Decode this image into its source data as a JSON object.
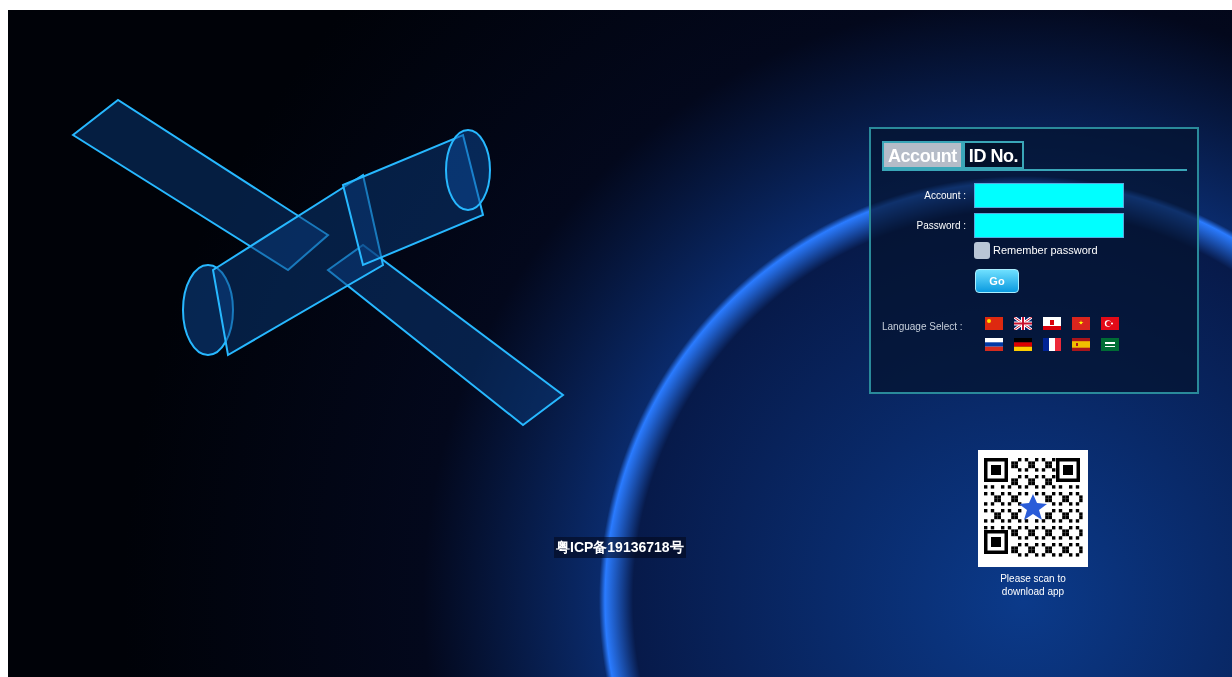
{
  "login_panel": {
    "tabs": [
      {
        "label": "Account",
        "selected": true
      },
      {
        "label": "ID No.",
        "selected": false
      }
    ],
    "fields": [
      {
        "label": "Account :"
      },
      {
        "label": "Password :"
      }
    ],
    "remember": {
      "label": "Remember password",
      "checked": false
    },
    "submit": "Go",
    "language": {
      "label": "Language Select :",
      "flags": [
        {
          "kind": "china"
        },
        {
          "kind": "uk"
        },
        {
          "kind": "gibraltar"
        },
        {
          "kind": "vietnam"
        },
        {
          "kind": "turkey"
        },
        {
          "kind": "russia"
        },
        {
          "kind": "germany"
        },
        {
          "kind": "france"
        },
        {
          "kind": "spain"
        },
        {
          "kind": "saudi"
        }
      ]
    }
  },
  "qr": {
    "caption": "Please scan to download app"
  },
  "footer": {
    "icp": "粤ICP备19136718号"
  }
}
